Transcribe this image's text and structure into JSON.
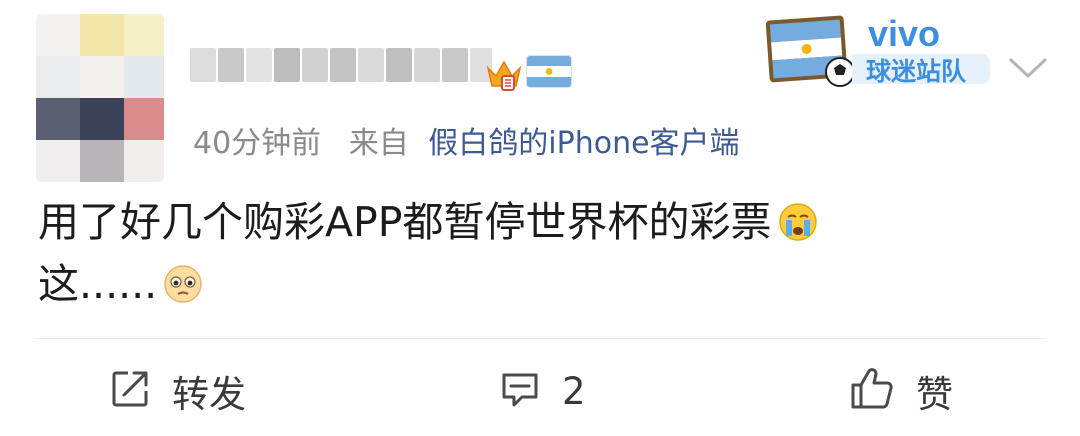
{
  "post": {
    "time": "40分钟前",
    "source_prefix": "来自",
    "device": "假白鸽的iPhone客户端",
    "text_line1": "用了好几个购彩APP都暂停世界杯的彩票",
    "text_line2": "这......"
  },
  "badges": {
    "flag_icon": "argentina-flag-icon",
    "vip_icon": "vip-crown-icon",
    "fan_badge_brand": "vivo",
    "fan_badge_label": "球迷站队"
  },
  "actions": {
    "repost_label": "转发",
    "comment_count": "2",
    "like_label": "赞"
  },
  "colors": {
    "link_blue": "#3d5a94",
    "meta_gray": "#8a8a8a",
    "vivo_blue": "#3c8fe0"
  }
}
